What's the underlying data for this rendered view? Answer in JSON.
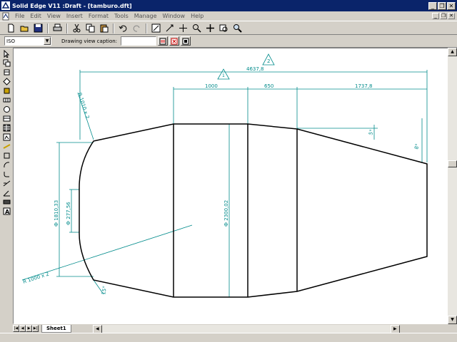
{
  "window": {
    "title": "Solid Edge V11 :Draft - [tamburo.dft]"
  },
  "menu": {
    "items": [
      "File",
      "Edit",
      "View",
      "Insert",
      "Format",
      "Tools",
      "Manage",
      "Window",
      "Help"
    ]
  },
  "toolbar": {
    "icons": [
      "new-icon",
      "open-icon",
      "save-icon",
      "print-icon",
      "cut-icon",
      "copy-icon",
      "paste-icon",
      "undo-icon",
      "redo-icon",
      "zoom-area-icon",
      "fit-icon",
      "pan-icon",
      "zoom-icon"
    ]
  },
  "view_bar": {
    "view_select_value": "ISO",
    "caption_label": "Drawing view caption:",
    "caption_value": ""
  },
  "tabs": {
    "sheet": "Sheet1"
  },
  "drawing": {
    "callouts": [
      "1",
      "2"
    ],
    "dims": {
      "overall": "4637,8",
      "seg1": "1000",
      "seg2": "650",
      "seg3": "1737,8",
      "diam_main": "Ф 2300,02",
      "diam_left1": "Ф 1810,33",
      "diam_left2": "Ф 277,56",
      "radius_top": "R 1010 x 2",
      "radius_bottom": "R 1000 x 2",
      "angle1": "5°",
      "angle2": "8°",
      "angle3": "15°"
    }
  },
  "colors": {
    "title_bg": "#0a246a",
    "dim_line": "#008b8b",
    "drawing_line": "#000000"
  }
}
